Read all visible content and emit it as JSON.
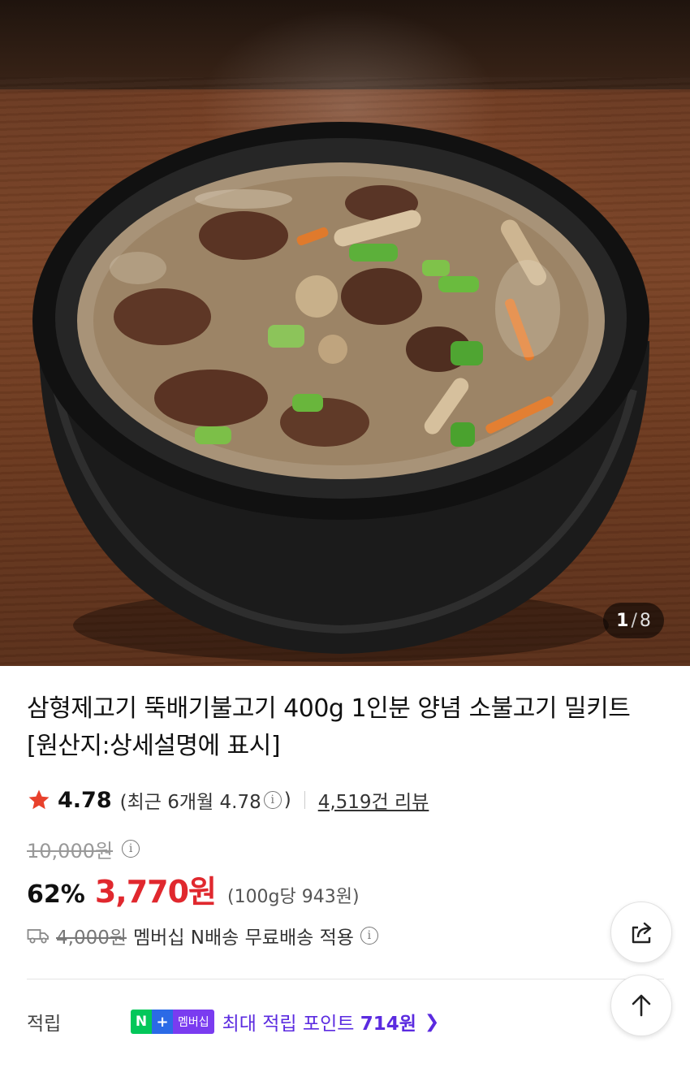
{
  "gallery": {
    "current": "1",
    "separator": "/",
    "total": "8",
    "image_alt": "뚝배기 불고기"
  },
  "product": {
    "title": "삼형제고기 뚝배기불고기 400g 1인분 양념 소불고기 밀키트 [원산지:상세설명에 표시]"
  },
  "rating": {
    "value": "4.78",
    "recent_prefix": "(최근 6개월 4.78",
    "recent_suffix": ")",
    "review_count": "4,519건 리뷰",
    "star_color": "#e8412c"
  },
  "price": {
    "original": "10,000원",
    "discount": "62%",
    "sale": "3,770원",
    "unit": "(100g당 943원)",
    "sale_color": "#e0282e"
  },
  "shipping": {
    "old_fee": "4,000원",
    "note": "멤버십 N배송 무료배송 적용"
  },
  "points": {
    "label": "적립",
    "badge_n": "N",
    "badge_plus": "+",
    "badge_membership": "멤버십",
    "text_prefix": "최대 적립 포인트 ",
    "amount": "714원",
    "accent_color": "#5b2be0"
  },
  "icons": {
    "share": "share-icon",
    "top": "arrow-up-icon",
    "info": "info-icon",
    "truck": "truck-icon",
    "star": "star-icon"
  }
}
